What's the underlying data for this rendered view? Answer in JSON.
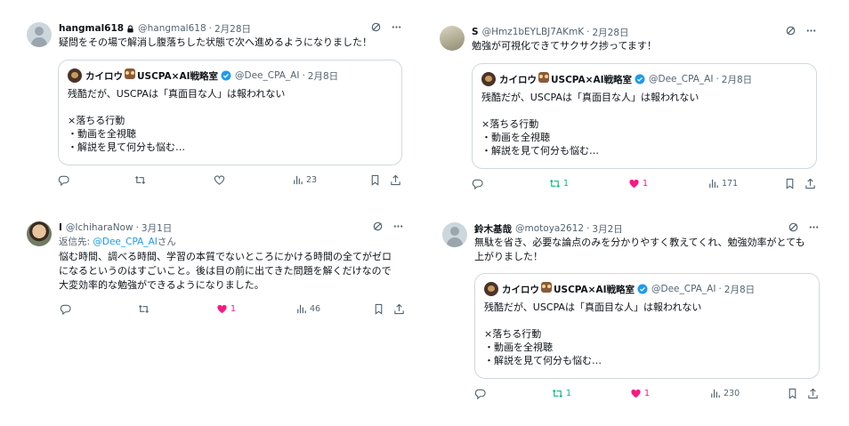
{
  "tweets": [
    {
      "name": "hangmal618",
      "handle": "@hangmal618",
      "date": "2月28日",
      "text": "疑問をその場で解消し腹落ちした状態で次へ進めるようになりました！",
      "actions": {
        "replies": "",
        "retweets": "",
        "likes": "",
        "views": "23"
      }
    },
    {
      "name": "S",
      "handle": "@Hmz1bEYLBJ7AKmK",
      "date": "2月28日",
      "text": "勉強が可視化できてサクサク捗ってます！",
      "actions": {
        "replies": "",
        "retweets": "1",
        "likes": "1",
        "views": "171"
      }
    },
    {
      "name": "I",
      "handle": "@IchiharaNow",
      "date": "3月1日",
      "reply_prefix": "返信先: ",
      "reply_mention": "@Dee_CPA_AI",
      "reply_suffix": "さん",
      "text_lines": [
        "悩む時間、調べる時間、学習の本質でないところにかける時間の全てがゼロ",
        "になるというのはすごいこと。後は目の前に出てきた問題を解くだけなので",
        "大変効率的な勉強ができるようになりました。"
      ],
      "actions": {
        "replies": "",
        "retweets": "",
        "likes": "1",
        "views": "46"
      }
    },
    {
      "name": "鈴木基哉",
      "handle": "@motoya2612",
      "date": "3月2日",
      "text_lines": [
        "無駄を省き、必要な論点のみを分かりやすく教えてくれ、勉強効率がとても",
        "上がりました！"
      ],
      "actions": {
        "replies": "",
        "retweets": "1",
        "likes": "1",
        "views": "230"
      }
    }
  ],
  "quote": {
    "name_part1": "カイロウ",
    "name_part2": "USCPA×AI戦略室",
    "handle": "@Dee_CPA_AI",
    "date": "2月8日",
    "line1": "残酷だが、USCPAは「真面目な人」は報われない",
    "line2": "×落ちる行動",
    "line3": "・動画を全視聴",
    "line4": "・解説を見て何分も悩む…"
  },
  "colors": {
    "like": "#f91880",
    "retweet": "#00ba7c",
    "verified": "#1d9bf0",
    "muted": "#536471"
  }
}
